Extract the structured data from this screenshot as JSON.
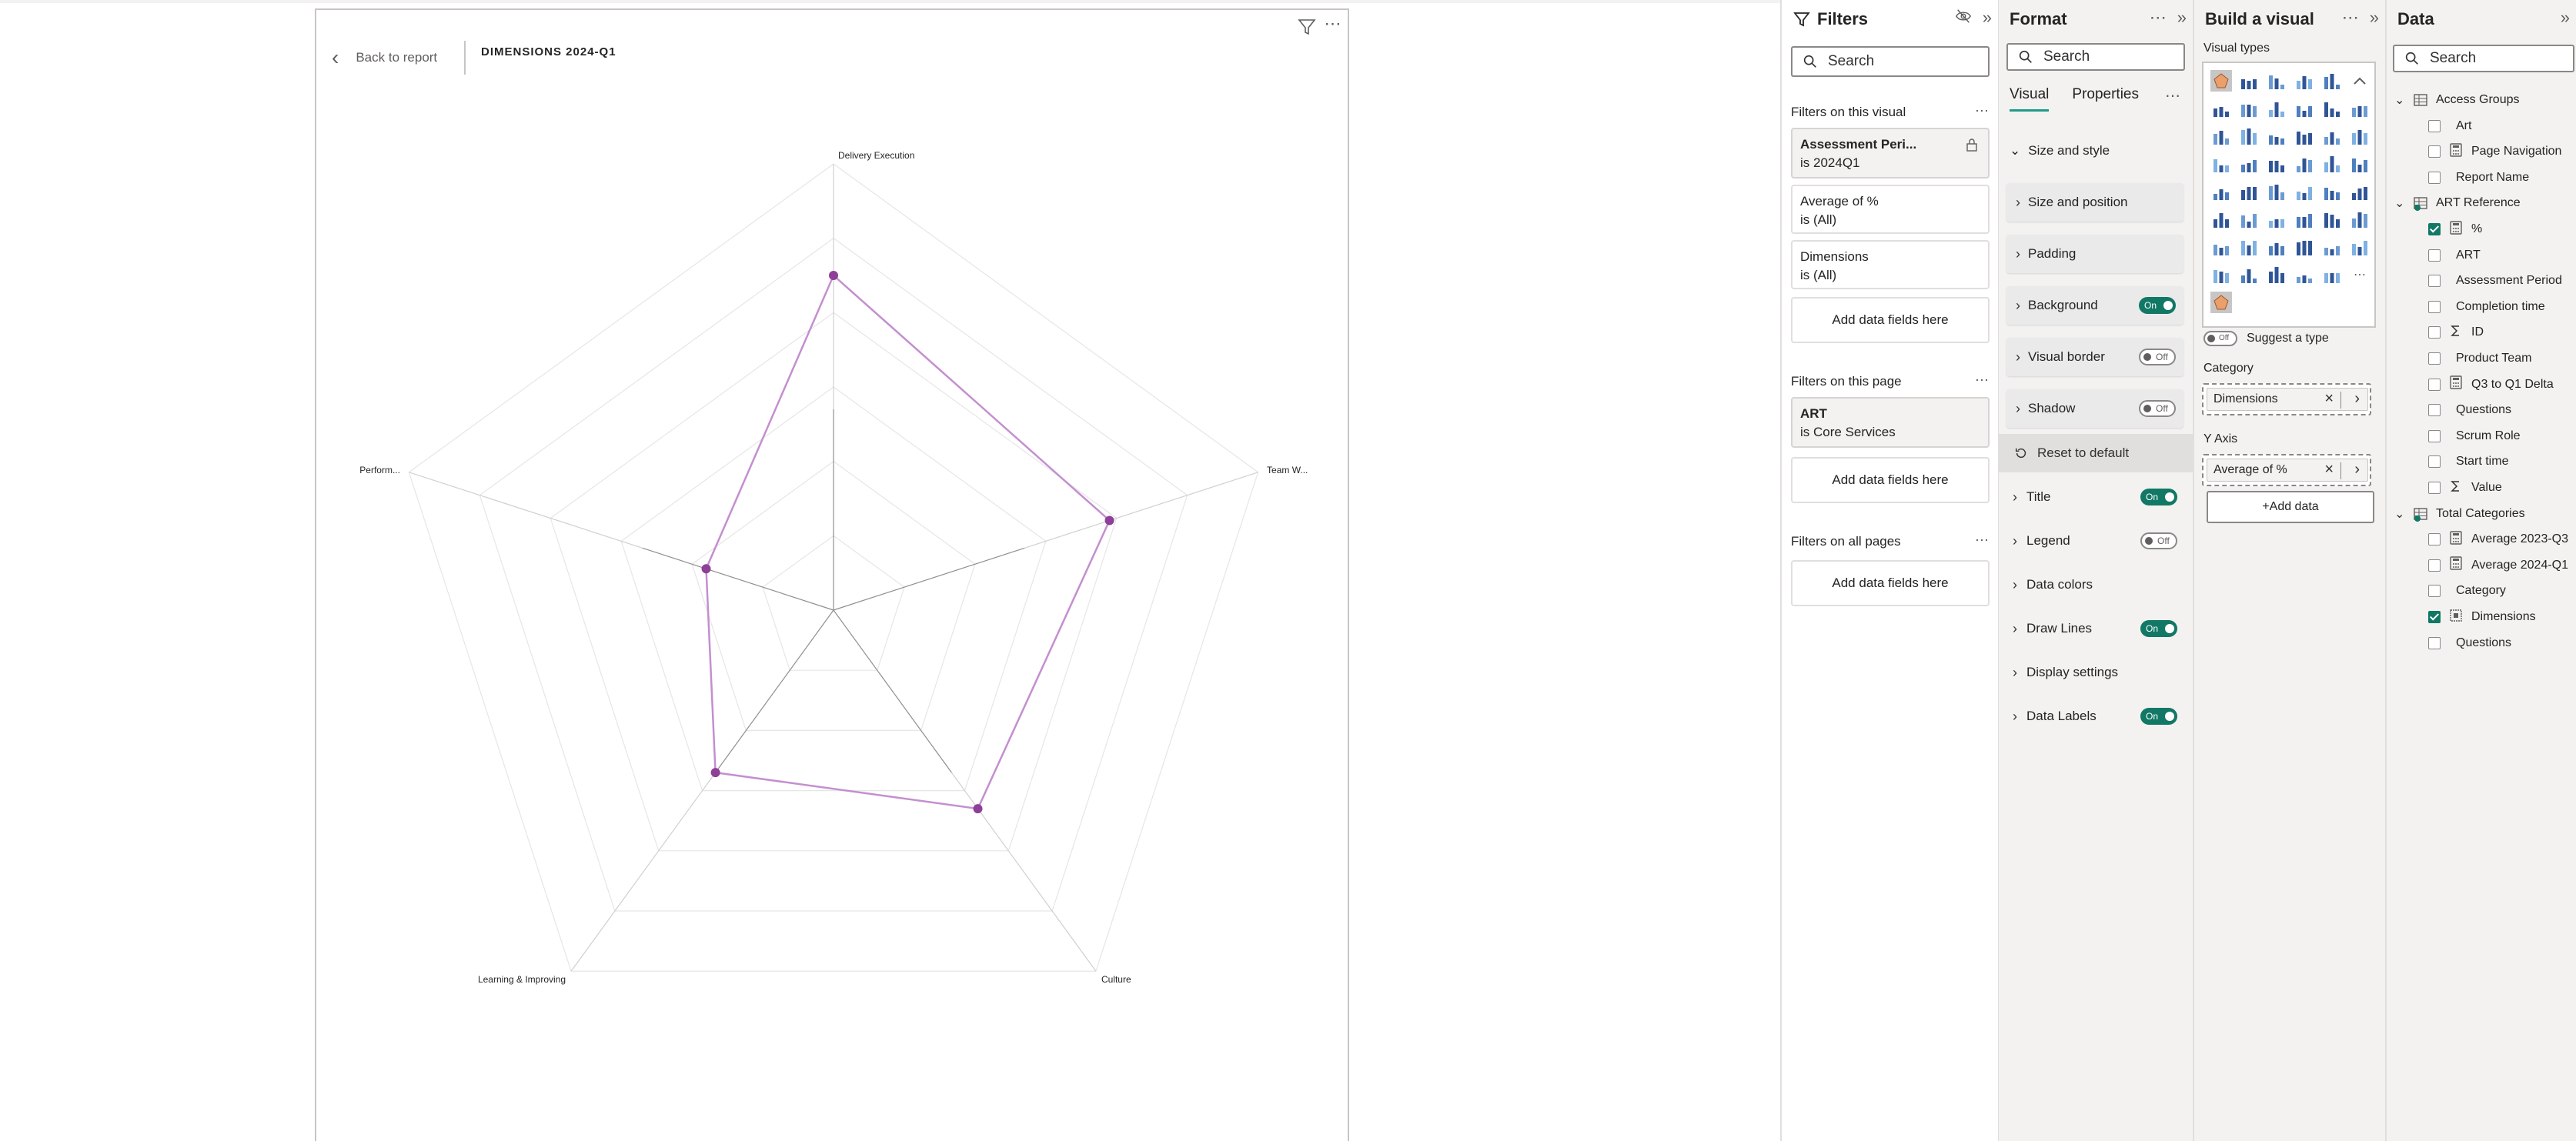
{
  "visual": {
    "back_label": "Back to report",
    "title": "DIMENSIONS 2024-Q1",
    "more": "⋯"
  },
  "chart_data": {
    "type": "radar",
    "categories": [
      "Delivery Execution",
      "Team W...",
      "Culture",
      "Learning & Improving",
      "Perform..."
    ],
    "series": [
      {
        "values": [
          0.75,
          0.65,
          0.55,
          0.45,
          0.3
        ],
        "color": "#8e3f98"
      }
    ],
    "rlim": [
      0,
      1
    ],
    "grid": true,
    "legend": "off"
  },
  "filters": {
    "title": "Filters",
    "search_placeholder": "Search",
    "on_visual_label": "Filters on this visual",
    "visual_filters": [
      {
        "name": "Assessment Peri...",
        "value": "is 2024Q1"
      },
      {
        "name": "Average of %",
        "value": "is (All)"
      },
      {
        "name": "Dimensions",
        "value": "is (All)"
      }
    ],
    "add_fields": "Add data fields here",
    "on_page_label": "Filters on this page",
    "page_filters": [
      {
        "name": "ART",
        "value": "is Core Services"
      }
    ],
    "all_pages_label": "Filters on all pages",
    "more": "⋯"
  },
  "format": {
    "title": "Format",
    "search_placeholder": "Search",
    "tabs": [
      "Visual",
      "Properties"
    ],
    "size_style_label": "Size and style",
    "cards": [
      "Size and position",
      "Padding",
      "Background",
      "Visual border",
      "Shadow"
    ],
    "card_toggles": [
      "",
      "",
      "On",
      "Off",
      "Off"
    ],
    "reset_label": "Reset to default",
    "sections": [
      "Title",
      "Legend",
      "Data colors",
      "Draw Lines",
      "Display settings",
      "Data Labels"
    ],
    "section_toggles": [
      "On",
      "Off",
      "",
      "On",
      "",
      "On"
    ]
  },
  "build": {
    "title": "Build a visual",
    "visual_types_label": "Visual types",
    "suggest_label": "Suggest a type",
    "suggest_toggle": "Off",
    "category_label": "Category",
    "category_field": "Dimensions",
    "yaxis_label": "Y Axis",
    "yaxis_field": "Average of %",
    "add_data": "+Add data"
  },
  "data": {
    "title": "Data",
    "search_placeholder": "Search",
    "tables": [
      {
        "name": "Access Groups",
        "fields": [
          {
            "name": "Art",
            "checked": false,
            "icon": "none"
          },
          {
            "name": "Page Navigation",
            "checked": false,
            "icon": "calc-icon"
          },
          {
            "name": "Report Name",
            "checked": false,
            "icon": "none"
          }
        ]
      },
      {
        "name": "ART Reference",
        "fields": [
          {
            "name": "%",
            "checked": true,
            "icon": "calc-icon"
          },
          {
            "name": "ART",
            "checked": false,
            "icon": "none"
          },
          {
            "name": "Assessment Period",
            "checked": false,
            "icon": "none"
          },
          {
            "name": "Completion time",
            "checked": false,
            "icon": "none"
          },
          {
            "name": "ID",
            "checked": false,
            "icon": "sigma-icon"
          },
          {
            "name": "Product Team",
            "checked": false,
            "icon": "none"
          },
          {
            "name": "Q3 to Q1 Delta",
            "checked": false,
            "icon": "calc-icon"
          },
          {
            "name": "Questions",
            "checked": false,
            "icon": "none"
          },
          {
            "name": "Scrum Role",
            "checked": false,
            "icon": "none"
          },
          {
            "name": "Start time",
            "checked": false,
            "icon": "none"
          },
          {
            "name": "Value",
            "checked": false,
            "icon": "sigma-icon"
          }
        ]
      },
      {
        "name": "Total Categories",
        "fields": [
          {
            "name": "Average 2023-Q3",
            "checked": false,
            "icon": "calc-icon"
          },
          {
            "name": "Average 2024-Q1",
            "checked": false,
            "icon": "calc-icon"
          },
          {
            "name": "Category",
            "checked": false,
            "icon": "none"
          },
          {
            "name": "Dimensions",
            "checked": true,
            "icon": "hierarchy-icon"
          },
          {
            "name": "Questions",
            "checked": false,
            "icon": "none"
          }
        ]
      }
    ]
  },
  "colors": {
    "accent": "#117865",
    "radar_line": "#c48fcf",
    "radar_point": "#8e3f98"
  }
}
